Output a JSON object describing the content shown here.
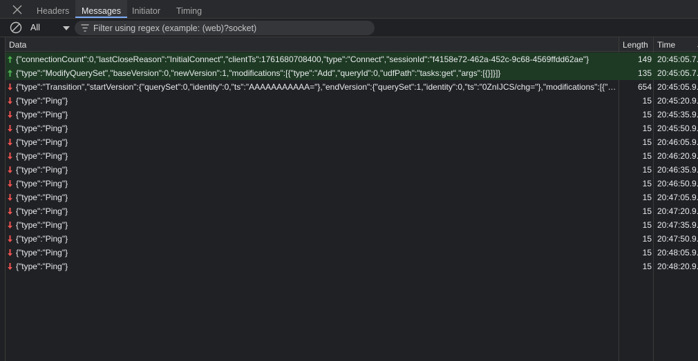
{
  "tabs": [
    {
      "label": "Headers",
      "active": false
    },
    {
      "label": "Messages",
      "active": true
    },
    {
      "label": "Initiator",
      "active": false
    },
    {
      "label": "Timing",
      "active": false
    }
  ],
  "toolbar": {
    "filter_type": "All",
    "regex_placeholder": "Filter using regex (example: (web)?socket)",
    "regex_value": ""
  },
  "columns": {
    "data": "Data",
    "length": "Length",
    "time": "Time"
  },
  "colors": {
    "sent_arrow": "#4caf50",
    "received_arrow": "#ef5350",
    "sent_row_bg": "#1e3a24"
  },
  "messages": [
    {
      "direction": "sent",
      "data": "{\"connectionCount\":0,\"lastCloseReason\":\"InitialConnect\",\"clientTs\":1761680708400,\"type\":\"Connect\",\"sessionId\":\"f4158e72-462a-452c-9c68-4569ffdd62ae\"}",
      "length": "149",
      "time": "20:45:05.7..."
    },
    {
      "direction": "sent",
      "data": "{\"type\":\"ModifyQuerySet\",\"baseVersion\":0,\"newVersion\":1,\"modifications\":[{\"type\":\"Add\",\"queryId\":0,\"udfPath\":\"tasks:get\",\"args\":[{}]}]}",
      "length": "135",
      "time": "20:45:05.7..."
    },
    {
      "direction": "received",
      "data": "{\"type\":\"Transition\",\"startVersion\":{\"querySet\":0,\"identity\":0,\"ts\":\"AAAAAAAAAAA=\"},\"endVersion\":{\"querySet\":1,\"identity\":0,\"ts\":\"0ZnIJCS/chg=\"},\"modifications\":[{\"ty...",
      "length": "654",
      "time": "20:45:05.9..."
    },
    {
      "direction": "received",
      "data": "{\"type\":\"Ping\"}",
      "length": "15",
      "time": "20:45:20.9..."
    },
    {
      "direction": "received",
      "data": "{\"type\":\"Ping\"}",
      "length": "15",
      "time": "20:45:35.9..."
    },
    {
      "direction": "received",
      "data": "{\"type\":\"Ping\"}",
      "length": "15",
      "time": "20:45:50.9..."
    },
    {
      "direction": "received",
      "data": "{\"type\":\"Ping\"}",
      "length": "15",
      "time": "20:46:05.9..."
    },
    {
      "direction": "received",
      "data": "{\"type\":\"Ping\"}",
      "length": "15",
      "time": "20:46:20.9..."
    },
    {
      "direction": "received",
      "data": "{\"type\":\"Ping\"}",
      "length": "15",
      "time": "20:46:35.9..."
    },
    {
      "direction": "received",
      "data": "{\"type\":\"Ping\"}",
      "length": "15",
      "time": "20:46:50.9..."
    },
    {
      "direction": "received",
      "data": "{\"type\":\"Ping\"}",
      "length": "15",
      "time": "20:47:05.9..."
    },
    {
      "direction": "received",
      "data": "{\"type\":\"Ping\"}",
      "length": "15",
      "time": "20:47:20.9..."
    },
    {
      "direction": "received",
      "data": "{\"type\":\"Ping\"}",
      "length": "15",
      "time": "20:47:35.9..."
    },
    {
      "direction": "received",
      "data": "{\"type\":\"Ping\"}",
      "length": "15",
      "time": "20:47:50.9..."
    },
    {
      "direction": "received",
      "data": "{\"type\":\"Ping\"}",
      "length": "15",
      "time": "20:48:05.9..."
    },
    {
      "direction": "received",
      "data": "{\"type\":\"Ping\"}",
      "length": "15",
      "time": "20:48:20.9..."
    }
  ]
}
